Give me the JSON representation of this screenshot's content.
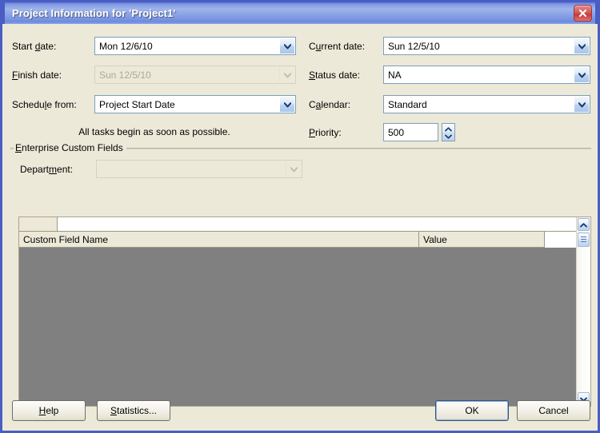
{
  "window": {
    "title": "Project Information for 'Project1'",
    "close_icon": "close-icon"
  },
  "form": {
    "start_date": {
      "label_pre": "Start ",
      "label_accel": "d",
      "label_post": "ate:",
      "value": "Mon 12/6/10"
    },
    "finish_date": {
      "label_pre": "",
      "label_accel": "F",
      "label_post": "inish date:",
      "value": "Sun 12/5/10"
    },
    "schedule_from": {
      "label_pre": "Schedu",
      "label_accel": "l",
      "label_post": "e from:",
      "value": "Project Start Date"
    },
    "current_date": {
      "label_pre": "C",
      "label_accel": "u",
      "label_post": "rrent date:",
      "value": "Sun 12/5/10"
    },
    "status_date": {
      "label_pre": "",
      "label_accel": "S",
      "label_post": "tatus date:",
      "value": "NA"
    },
    "calendar": {
      "label_pre": "C",
      "label_accel": "a",
      "label_post": "lendar:",
      "value": "Standard"
    },
    "priority": {
      "label_pre": "",
      "label_accel": "P",
      "label_post": "riority:",
      "value": "500"
    },
    "note": "All tasks begin as soon as possible."
  },
  "enterprise_custom_fields": {
    "group_title_pre": "",
    "group_title_accel": "E",
    "group_title_post": "nterprise Custom Fields",
    "department": {
      "label_pre": "Depart",
      "label_accel": "m",
      "label_post": "ent:",
      "value": ""
    },
    "grid": {
      "columns": [
        "Custom Field Name",
        "Value"
      ],
      "rows": []
    }
  },
  "buttons": {
    "help": {
      "pre": "",
      "accel": "H",
      "post": "elp"
    },
    "statistics": {
      "pre": "",
      "accel": "S",
      "post": "tatistics..."
    },
    "ok": {
      "pre": "OK",
      "accel": "",
      "post": ""
    },
    "cancel": {
      "pre": "Cancel",
      "accel": "",
      "post": ""
    }
  },
  "colors": {
    "title_bar": "#7d97e3",
    "dialog_face": "#ece9d8",
    "grid_body": "#808080",
    "close_button": "#c63b3b",
    "combo_border": "#7f9db9"
  }
}
